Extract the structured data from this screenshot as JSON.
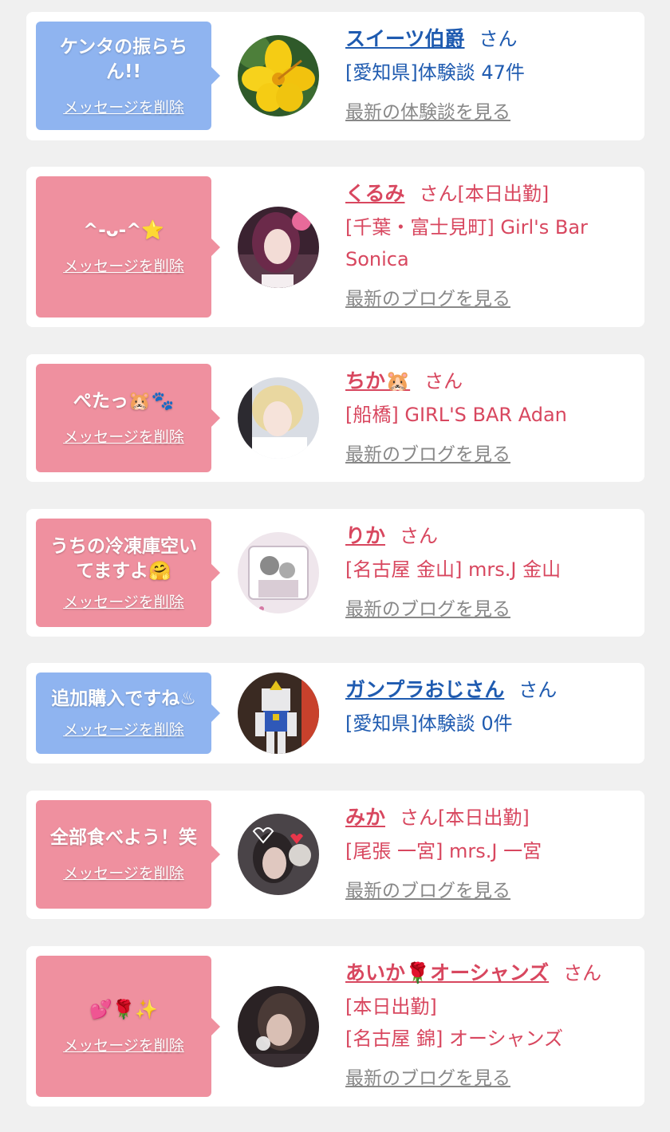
{
  "messages": [
    {
      "bubble_text": "ケンタの振らちん!!",
      "delete_label": "メッセージを削除",
      "name": "スイーツ伯爵",
      "san": "さん",
      "detail_lines": [
        "[愛知県]体験談 47件"
      ],
      "link": "最新の体験談を見る"
    },
    {
      "bubble_text": "^-ᴗ-^⭐",
      "delete_label": "メッセージを削除",
      "name": "くるみ",
      "san": "さん[本日出勤]",
      "detail_lines": [
        "[千葉・富士見町] Girl's Bar Sonica"
      ],
      "link": "最新のブログを見る"
    },
    {
      "bubble_text": "ぺたっ🐹🐾",
      "delete_label": "メッセージを削除",
      "name": "ちか🐹",
      "san": "さん",
      "detail_lines": [
        "[船橋] GIRL'S BAR Adan"
      ],
      "link": "最新のブログを見る"
    },
    {
      "bubble_text": "うちの冷凍庫空いてますよ🤗",
      "delete_label": "メッセージを削除",
      "name": "りか",
      "san": "さん",
      "detail_lines": [
        "[名古屋 金山] mrs.J 金山"
      ],
      "link": "最新のブログを見る"
    },
    {
      "bubble_text": "追加購入ですね♨",
      "delete_label": "メッセージを削除",
      "name": "ガンプラおじさん",
      "san": "さん",
      "detail_lines": [
        "[愛知県]体験談 0件"
      ],
      "link": ""
    },
    {
      "bubble_text": "全部食べよう！笑",
      "delete_label": "メッセージを削除",
      "name": "みか",
      "san": "さん[本日出勤]",
      "detail_lines": [
        "[尾張 一宮] mrs.J 一宮"
      ],
      "link": "最新のブログを見る"
    },
    {
      "bubble_text": "💕🌹✨",
      "delete_label": "メッセージを削除",
      "name": "あいか🌹オーシャンズ",
      "san": "さん",
      "detail_lines": [
        "[本日出勤]",
        "[名古屋 錦] オーシャンズ"
      ],
      "link": "最新のブログを見る"
    }
  ],
  "colors": {
    "pink_bubble": "#ef909f",
    "blue_bubble": "#8fb4f0",
    "pink_text": "#d8475f",
    "blue_text": "#1f5bb0",
    "link_gray": "#888888"
  }
}
